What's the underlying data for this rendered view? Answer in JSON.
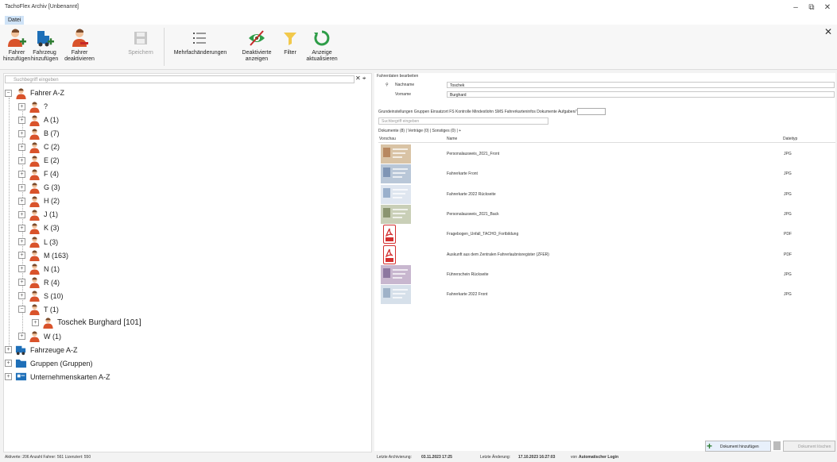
{
  "window": {
    "title": "TachoFlex Archiv [Unbenannt]",
    "min": "–",
    "restore": "⧉",
    "close": "✕"
  },
  "menu": {
    "file": "Datei"
  },
  "ribbon": {
    "add_driver": [
      "Fahrer",
      "hinzufügen"
    ],
    "add_vehicle": [
      "Fahrzeug",
      "hinzufügen"
    ],
    "deactivate_driver": [
      "Fahrer",
      "deaktivieren"
    ],
    "save": [
      "Speichern",
      ""
    ],
    "multi_change": [
      "Mehrfachänderungen",
      ""
    ],
    "show_deactivated": [
      "Deaktivierte",
      "anzeigen"
    ],
    "filter": [
      "Filter",
      ""
    ],
    "refresh": [
      "Anzeige",
      "aktualisieren"
    ]
  },
  "left": {
    "search_placeholder": "Suchbegriff eingeben",
    "search_icons": "✕ ⌖",
    "tree": {
      "root": "Fahrer A-Z",
      "groups": [
        "?",
        "A (1)",
        "B (7)",
        "C (2)",
        "E (2)",
        "F (4)",
        "G (3)",
        "H (2)",
        "J (1)",
        "K (3)",
        "L (3)",
        "M (163)",
        "N (1)",
        "R (4)",
        "S (10)",
        "T (1)"
      ],
      "selected_child": "Toschek Burghard [101]",
      "after": "W (1)",
      "vehicles": "Fahrzeuge A-Z",
      "groups_node": "Gruppen (Gruppen)",
      "company_cards": "Unternehmenskarten A-Z"
    }
  },
  "right": {
    "section_title": "Fahrerdaten bearbeiten",
    "lastname_label": "Nachname",
    "lastname_value": "Toschek",
    "firstname_label": "Vorname",
    "firstname_value": "Burghard",
    "tabs": "Grundeinstellungen  Gruppen  Einsatzort  FS Kontrolle  Mindestlohn  SMS  Fahrerkarteninfos  Dokumente  Aufgaben/Termine",
    "doc_search_placeholder": "Suchbegriff eingeben",
    "filter_tabs": "Dokumente (8) | Verträge (0) | Sonstiges (0) | +",
    "col_preview": "Vorschau",
    "col_name": "Name",
    "col_type": "Dateityp",
    "documents": [
      {
        "name": "Personalausweis_2021_Front",
        "type": "JPG",
        "kind": "photo"
      },
      {
        "name": "Fahrerkarte Front",
        "type": "JPG",
        "kind": "photo"
      },
      {
        "name": "Fahrerkarte 2022 Rückseite",
        "type": "JPG",
        "kind": "photo"
      },
      {
        "name": "Personalausweis_2021_Back",
        "type": "JPG",
        "kind": "photo"
      },
      {
        "name": "Fragebogen_Unfall_TACHO_Fortbildung",
        "type": "PDF",
        "kind": "pdf"
      },
      {
        "name": "Auskunft aus dem Zentralen Fahrerlaubnisregister (ZFER)",
        "type": "PDF",
        "kind": "pdf"
      },
      {
        "name": "Führerschein Rückseite",
        "type": "JPG",
        "kind": "photo"
      },
      {
        "name": "Fahrerkarte 2022 Front",
        "type": "JPG",
        "kind": "photo"
      }
    ],
    "add_doc_button": "Dokument hinzufügen",
    "delete_doc_button": "Dokument löschen"
  },
  "status": {
    "left": "Aktiverte: 206  Anzahl Fahrer: 561  Lizenziert: 550",
    "archive_label": "Letzte Archivierung:",
    "archive_value": "03.11.2023 17:25",
    "change_label": "Letzte Änderung:",
    "change_value": "17.10.2023 16:27:03",
    "change_by": "von",
    "user": "Automatischer Login"
  },
  "colors": {
    "accent": "#2e7d32",
    "orange": "#d9532b",
    "blue": "#1e6fb8",
    "pdf_red": "#d32f2f"
  }
}
